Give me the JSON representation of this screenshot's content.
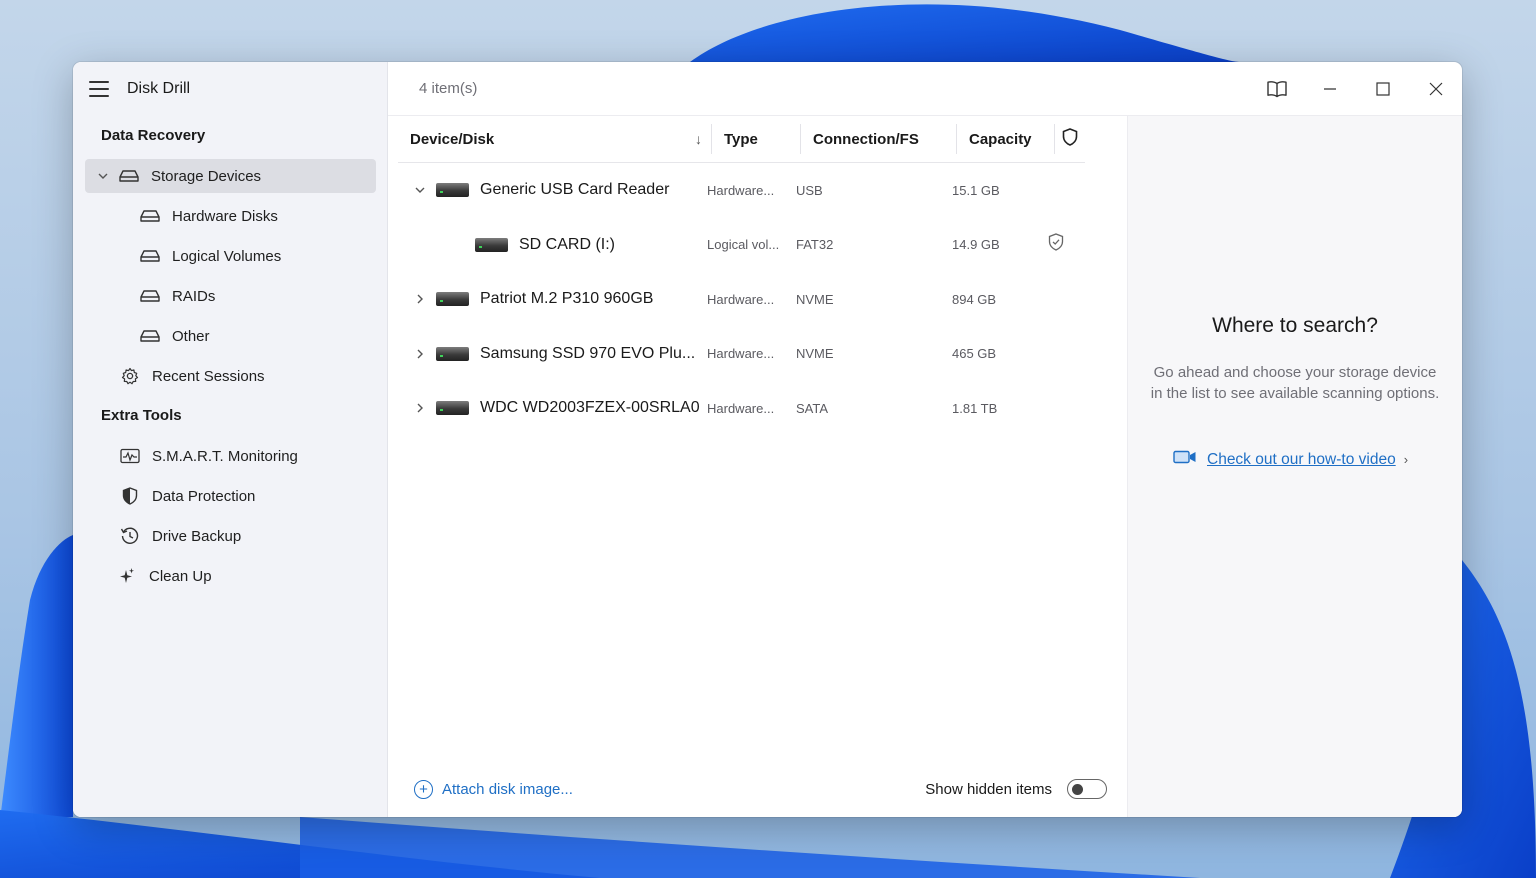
{
  "app": {
    "title": "Disk Drill"
  },
  "sidebar": {
    "sections": [
      {
        "label": "Data Recovery"
      },
      {
        "label": "Extra Tools"
      }
    ],
    "recovery_items": [
      {
        "label": "Storage Devices",
        "icon": "drive-icon",
        "selected": true
      },
      {
        "label": "Hardware Disks",
        "icon": "drive-icon"
      },
      {
        "label": "Logical Volumes",
        "icon": "drive-icon"
      },
      {
        "label": "RAIDs",
        "icon": "drive-icon"
      },
      {
        "label": "Other",
        "icon": "drive-icon"
      },
      {
        "label": "Recent Sessions",
        "icon": "gear-icon"
      }
    ],
    "tools_items": [
      {
        "label": "S.M.A.R.T. Monitoring",
        "icon": "monitor-pulse-icon"
      },
      {
        "label": "Data Protection",
        "icon": "shield-half-icon"
      },
      {
        "label": "Drive Backup",
        "icon": "history-clock-icon"
      },
      {
        "label": "Clean Up",
        "icon": "sparkle-icon"
      }
    ]
  },
  "main": {
    "item_count": "4 item(s)",
    "columns": {
      "device": "Device/Disk",
      "type": "Type",
      "connection": "Connection/FS",
      "capacity": "Capacity"
    },
    "rows": [
      {
        "name": "Generic USB Card Reader",
        "type": "Hardware...",
        "connection": "USB",
        "capacity": "15.1 GB",
        "expanded": true,
        "child": false
      },
      {
        "name": "SD CARD (I:)",
        "type": "Logical vol...",
        "connection": "FAT32",
        "capacity": "14.9 GB",
        "child": true,
        "protected": true
      },
      {
        "name": "Patriot M.2 P310 960GB",
        "type": "Hardware...",
        "connection": "NVME",
        "capacity": "894 GB",
        "expanded": false,
        "child": false
      },
      {
        "name": "Samsung SSD 970 EVO Plu...",
        "type": "Hardware...",
        "connection": "NVME",
        "capacity": "465 GB",
        "expanded": false,
        "child": false
      },
      {
        "name": "WDC WD2003FZEX-00SRLA0",
        "type": "Hardware...",
        "connection": "SATA",
        "capacity": "1.81 TB",
        "expanded": false,
        "child": false
      }
    ],
    "attach_label": "Attach disk image...",
    "show_hidden_label": "Show hidden items",
    "show_hidden_on": false
  },
  "side_panel": {
    "title": "Where to search?",
    "description": "Go ahead and choose your storage device in the list to see available scanning options.",
    "link": "Check out our how-to video"
  },
  "colors": {
    "accent": "#1f6fc5",
    "sidebar_bg": "#f2f3f8",
    "selected_bg": "#dcdde3"
  }
}
